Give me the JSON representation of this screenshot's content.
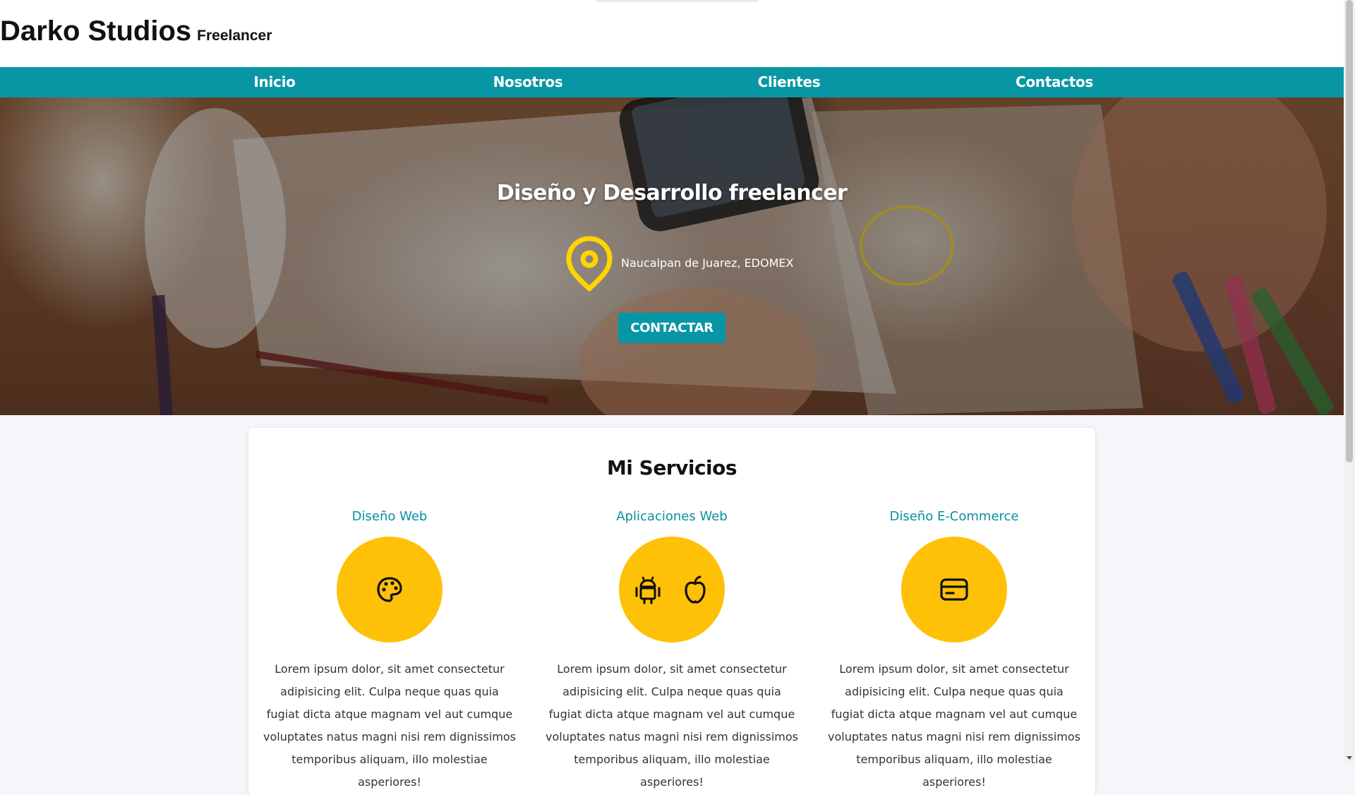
{
  "brand": {
    "name": "Darko Studios",
    "tagline": "Freelancer"
  },
  "nav": {
    "items": [
      "Inicio",
      "Nosotros",
      "Clientes",
      "Contactos"
    ]
  },
  "hero": {
    "title": "Diseño y Desarrollo freelancer",
    "location": "Naucalpan de Juarez, EDOMEX",
    "cta_label": "CONTACTAR"
  },
  "services": {
    "heading": "Mi Servicios",
    "items": [
      {
        "title": "Diseño Web",
        "icon": "palette-icon",
        "text": "Lorem ipsum dolor, sit amet consectetur adipisicing elit. Culpa neque quas quia fugiat dicta atque magnam vel aut cumque voluptates natus magni nisi rem dignissimos temporibus aliquam, illo molestiae asperiores!"
      },
      {
        "title": "Aplicaciones Web",
        "icon": "android-apple-icons",
        "text": "Lorem ipsum dolor, sit amet consectetur adipisicing elit. Culpa neque quas quia fugiat dicta atque magnam vel aut cumque voluptates natus magni nisi rem dignissimos temporibus aliquam, illo molestiae asperiores!"
      },
      {
        "title": "Diseño E-Commerce",
        "icon": "credit-card-icon",
        "text": "Lorem ipsum dolor, sit amet consectetur adipisicing elit. Culpa neque quas quia fugiat dicta atque magnam vel aut cumque voluptates natus magni nisi rem dignissimos temporibus aliquam, illo molestiae asperiores!"
      }
    ]
  },
  "colors": {
    "accent": "#0896a4",
    "service_title": "#0a8fa0",
    "icon_circle": "#ffc107",
    "pin": "#ffd400"
  }
}
